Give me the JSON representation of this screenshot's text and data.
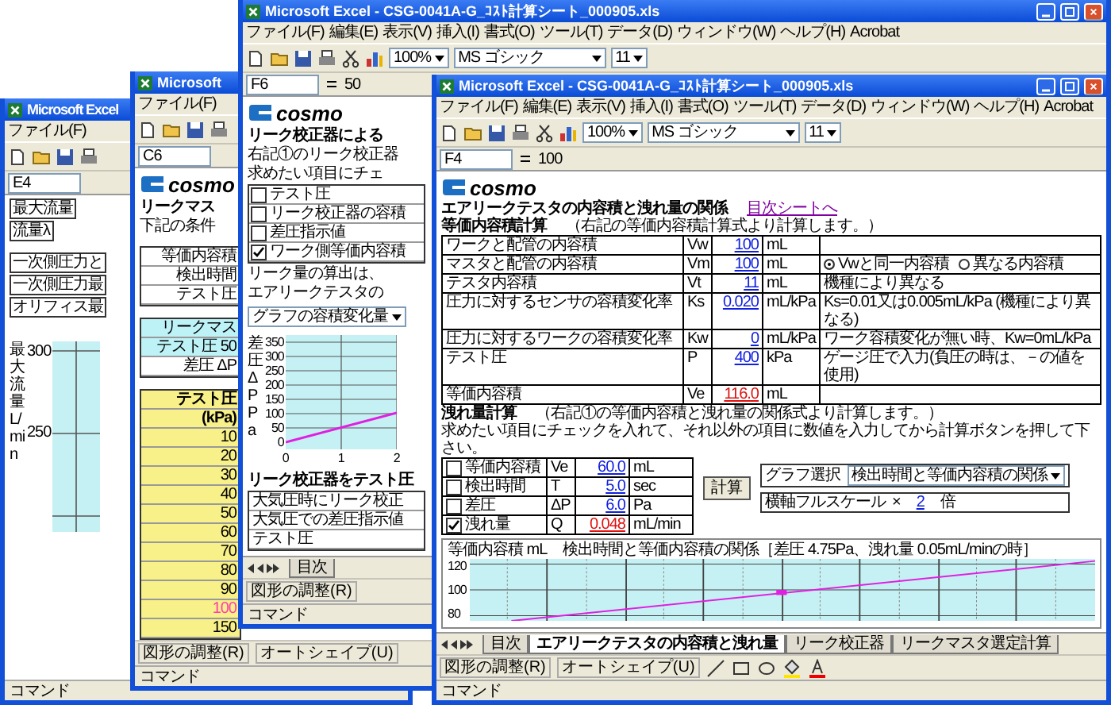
{
  "window_left": {
    "title": "Microsoft Excel",
    "menu_item": "ファイル(F)",
    "name_box": "E4",
    "cells": [
      "最大流量",
      "流量λ"
    ],
    "table": [
      "一次側圧力と",
      "一次側圧力最",
      "オリフィス最"
    ],
    "chart": {
      "y_label": "最大流量 L/min",
      "y_ticks": [
        "300",
        "250"
      ]
    },
    "status": "コマンド"
  },
  "window_second": {
    "title": "Microsoft",
    "menu_item": "ファイル(F)",
    "name_box": "C6",
    "logo": "cosmo",
    "heading": "リークマス",
    "intro": "下記の条件",
    "conditions": [
      "等価内容積",
      "検出時間",
      "テスト圧"
    ],
    "results": [
      "リークマス",
      "テスト圧 50",
      "差圧 ΔP"
    ],
    "pressure_header": [
      "テスト圧",
      "(kPa)"
    ],
    "pressures": [
      {
        "value": "10",
        "highlighted": false
      },
      {
        "value": "20",
        "highlighted": false
      },
      {
        "value": "30",
        "highlighted": false
      },
      {
        "value": "40",
        "highlighted": false
      },
      {
        "value": "50",
        "highlighted": false
      },
      {
        "value": "60",
        "highlighted": false
      },
      {
        "value": "70",
        "highlighted": false
      },
      {
        "value": "80",
        "highlighted": false
      },
      {
        "value": "90",
        "highlighted": false
      },
      {
        "value": "100",
        "highlighted": true
      },
      {
        "value": "150",
        "highlighted": false
      }
    ],
    "drawing_toolbar": [
      "図形の調整(R)",
      "オートシェイプ(U)"
    ],
    "status": "コマンド"
  },
  "window_third": {
    "title": "Microsoft Excel - CSG-0041A-G_ｺｽﾄ計算シート_000905.xls",
    "menu": [
      "ファイル(F)",
      "編集(E)",
      "表示(V)",
      "挿入(I)",
      "書式(O)",
      "ツール(T)",
      "データ(D)",
      "ウィンドウ(W)",
      "ヘルプ(H)",
      "Acrobat"
    ],
    "zoom": "100%",
    "font": "MS ゴシック",
    "font_size": "11",
    "name_box": "F6",
    "formula": "50",
    "logo": "cosmo",
    "heading": "リーク校正器による",
    "intro": [
      "右記①のリーク校正器",
      "求めたい項目にチェ"
    ],
    "options": [
      {
        "label": "テスト圧",
        "checked": false
      },
      {
        "label": "リーク校正器の容積",
        "checked": false
      },
      {
        "label": "差圧指示値",
        "checked": false
      },
      {
        "label": "ワーク側等価内容積",
        "checked": true
      }
    ],
    "notes": [
      "リーク量の算出は、",
      "エアリークテスタの"
    ],
    "scale_dropdown": "グラフの容積変化量",
    "chart": {
      "y_label": "差圧 ΔP Pa",
      "y_ticks": [
        "350",
        "300",
        "250",
        "200",
        "150",
        "100",
        "50",
        "0"
      ],
      "x_ticks": [
        "0",
        "1",
        "2"
      ]
    },
    "section_heading": "リーク校正器をテスト圧",
    "rows": [
      "大気圧時にリーク校正",
      "大気圧での差圧指示値",
      "テスト圧"
    ],
    "sheet_tab": "目次",
    "drawing_toolbar": "図形の調整(R)",
    "status": "コマンド"
  },
  "window_front": {
    "title": "Microsoft Excel - CSG-0041A-G_ｺｽﾄ計算シート_000905.xls",
    "menu": [
      "ファイル(F)",
      "編集(E)",
      "表示(V)",
      "挿入(I)",
      "書式(O)",
      "ツール(T)",
      "データ(D)",
      "ウィンドウ(W)",
      "ヘルプ(H)",
      "Acrobat"
    ],
    "zoom": "100%",
    "font": "MS ゴシック",
    "font_size": "11",
    "name_box": "F4",
    "formula": "100",
    "logo": "cosmo",
    "heading": "エアリークテスタの内容積と洩れ量の関係",
    "link": "目次シートへ",
    "volume_section": {
      "title": "等価内容積計算",
      "note": "（右記の等価内容積計算式より計算します。）"
    },
    "volume_rows": [
      {
        "label": "ワークと配管の内容積",
        "symbol": "Vw",
        "value": "100",
        "unit": "mL",
        "kind": "input"
      },
      {
        "label": "マスタと配管の内容積",
        "symbol": "Vm",
        "value": "100",
        "unit": "mL",
        "kind": "input",
        "choices": [
          {
            "label": "Vwと同一内容積",
            "selected": true
          },
          {
            "label": "異なる内容積",
            "selected": false
          }
        ]
      },
      {
        "label": "テスタ内容積",
        "symbol": "Vt",
        "value": "11",
        "unit": "mL",
        "kind": "input",
        "note": "機種により異なる"
      },
      {
        "label": "圧力に対するセンサの容積変化率",
        "symbol": "Ks",
        "value": "0.020",
        "unit": "mL/kPa",
        "kind": "input",
        "note": "Ks=0.01又は0.005mL/kPa (機種により異なる)"
      },
      {
        "label": "圧力に対するワークの容積変化率",
        "symbol": "Kw",
        "value": "0",
        "unit": "mL/kPa",
        "kind": "input",
        "note": "ワーク容積変化が無い時、Kw=0mL/kPa"
      },
      {
        "label": "テスト圧",
        "symbol": "P",
        "value": "400",
        "unit": "kPa",
        "kind": "input",
        "note": "ゲージ圧で入力(負圧の時は、－の値を使用)"
      },
      {
        "label": "等価内容積",
        "symbol": "Ve",
        "value": "116.0",
        "unit": "mL",
        "kind": "result"
      }
    ],
    "leak_section": {
      "title": "洩れ量計算",
      "note": "（右記①の等価内容積と洩れ量の関係式より計算します。）",
      "instruction": "求めたい項目にチェックを入れて、それ以外の項目に数値を入力してから計算ボタンを押して下さい。"
    },
    "leak_rows": [
      {
        "label": "等価内容積",
        "symbol": "Ve",
        "value": "60.0",
        "unit": "mL",
        "checked": false,
        "kind": "input"
      },
      {
        "label": "検出時間",
        "symbol": "T",
        "value": "5.0",
        "unit": "sec",
        "checked": false,
        "kind": "input"
      },
      {
        "label": "差圧",
        "symbol": "ΔP",
        "value": "6.0",
        "unit": "Pa",
        "checked": false,
        "kind": "input"
      },
      {
        "label": "洩れ量",
        "symbol": "Q",
        "value": "0.048",
        "unit": "mL/min",
        "checked": true,
        "kind": "result"
      }
    ],
    "calculate_button": "計算",
    "graph_select": {
      "label": "グラフ選択",
      "value": "検出時間と等価内容積の関係"
    },
    "scale_row": {
      "label": "横軸フルスケール",
      "sign": "×",
      "value": "2",
      "unit": "倍"
    },
    "chart": {
      "title": "検出時間と等価内容積の関係［差圧 4.75Pa、洩れ量 0.05mL/minの時］",
      "y_label": "等価内容積 mL",
      "y_ticks": [
        "120",
        "100",
        "80"
      ]
    },
    "sheet_tabs": [
      {
        "label": "目次",
        "selected": false
      },
      {
        "label": "エアリークテスタの内容積と洩れ量",
        "selected": true
      },
      {
        "label": "リーク校正器",
        "selected": false
      },
      {
        "label": "リークマスタ選定計算",
        "selected": false
      }
    ],
    "drawing_toolbar": [
      "図形の調整(R)",
      "オートシェイプ(U)"
    ],
    "status": "コマンド"
  }
}
